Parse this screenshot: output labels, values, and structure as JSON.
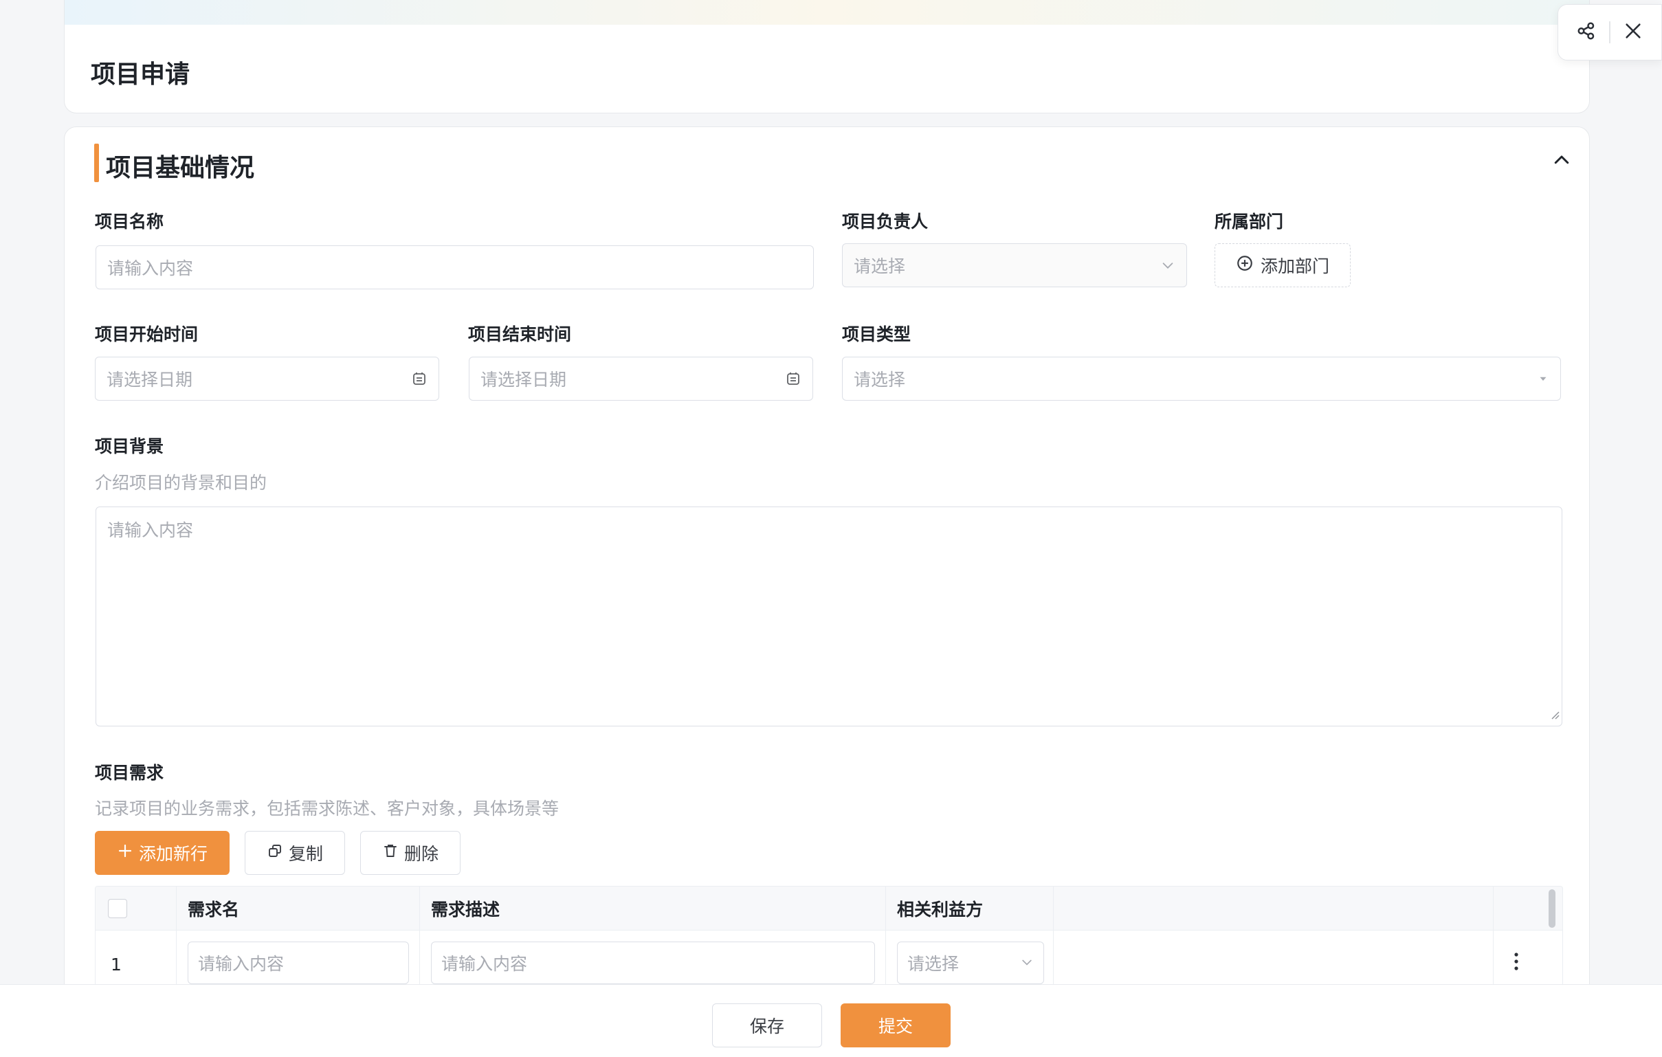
{
  "header": {
    "title": "项目申请"
  },
  "toolbar": {
    "share_icon": "share-icon",
    "close_icon": "close-icon"
  },
  "section": {
    "title": "项目基础情况",
    "collapse_icon": "chevron-up-icon"
  },
  "fields": {
    "project_name": {
      "label": "项目名称",
      "placeholder": "请输入内容"
    },
    "project_owner": {
      "label": "项目负责人",
      "placeholder": "请选择"
    },
    "department": {
      "label": "所属部门",
      "add_label": "添加部门"
    },
    "start_date": {
      "label": "项目开始时间",
      "placeholder": "请选择日期"
    },
    "end_date": {
      "label": "项目结束时间",
      "placeholder": "请选择日期"
    },
    "project_type": {
      "label": "项目类型",
      "placeholder": "请选择"
    },
    "background": {
      "label": "项目背景",
      "hint": "介绍项目的背景和目的",
      "placeholder": "请输入内容"
    }
  },
  "requirements": {
    "label": "项目需求",
    "hint": "记录项目的业务需求，包括需求陈述、客户对象，具体场景等",
    "actions": {
      "add_row": "添加新行",
      "copy": "复制",
      "delete": "删除"
    },
    "columns": [
      "需求名",
      "需求描述",
      "相关利益方"
    ],
    "rows": [
      {
        "index": "1",
        "name_placeholder": "请输入内容",
        "desc_placeholder": "请输入内容",
        "stakeholder_placeholder": "请选择"
      }
    ]
  },
  "footer": {
    "save": "保存",
    "submit": "提交"
  },
  "colors": {
    "accent": "#f0913e",
    "border": "#dcdfe6",
    "placeholder": "#a8abb2"
  }
}
